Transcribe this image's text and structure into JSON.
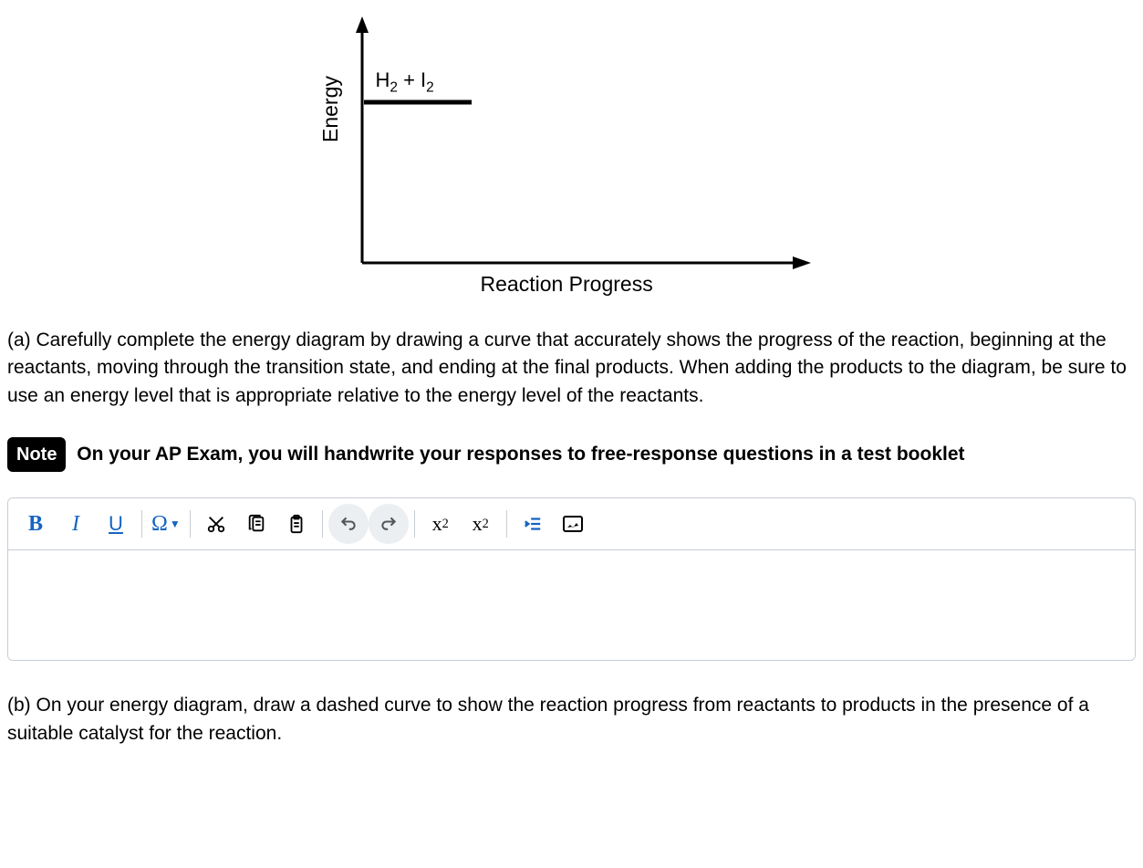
{
  "chart_data": {
    "type": "diagram",
    "ylabel": "Energy",
    "xlabel": "Reaction Progress",
    "reactants_label": "H₂ + I₂",
    "reactants_label_plain": "H2 + I2",
    "reactants_energy_level": "high",
    "curve_present": false
  },
  "question_a": "(a) Carefully complete the energy diagram by drawing a curve that accurately shows the progress of the reaction, beginning at the reactants, moving through the transition state, and ending at the final products. When adding the products to the diagram, be sure to use an energy level that is appropriate relative to the energy level of the reactants.",
  "note": {
    "badge": "Note",
    "text": "On your AP Exam, you will handwrite your responses to free-response questions in a test booklet"
  },
  "toolbar": {
    "bold": "B",
    "italic": "I",
    "underline": "U",
    "omega": "Ω",
    "superscript": "x²",
    "subscript": "x₂"
  },
  "question_b": "(b) On your energy diagram, draw a dashed curve to show the reaction progress from reactants to products in the presence of a suitable catalyst for the reaction."
}
